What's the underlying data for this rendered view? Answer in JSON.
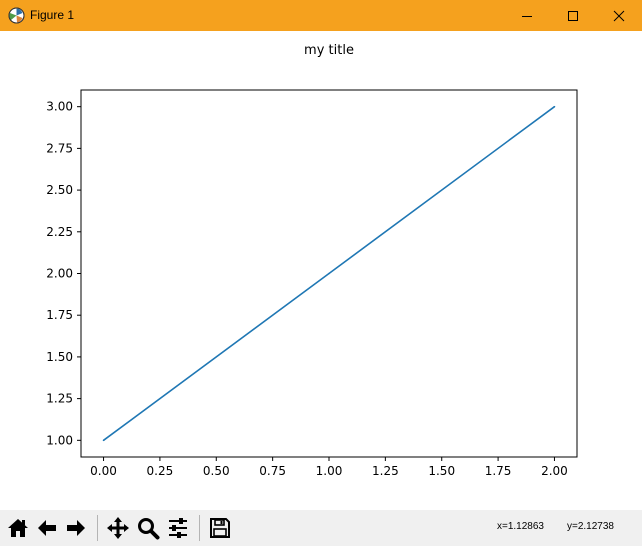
{
  "window": {
    "title": "Figure 1",
    "app_icon": "matplotlib-icon",
    "controls": [
      "minimize-icon",
      "maximize-icon",
      "close-icon"
    ],
    "titlebar_color": "#f5a11e"
  },
  "toolbar": {
    "buttons": [
      {
        "name": "home-button",
        "icon": "home-icon"
      },
      {
        "name": "back-button",
        "icon": "arrow-left-icon"
      },
      {
        "name": "forward-button",
        "icon": "arrow-right-icon"
      },
      {
        "name": "pan-button",
        "icon": "move-icon"
      },
      {
        "name": "zoom-button",
        "icon": "zoom-icon"
      },
      {
        "name": "configure-subplots-button",
        "icon": "sliders-icon"
      },
      {
        "name": "save-button",
        "icon": "save-icon"
      }
    ],
    "x_readout": "x=1.12863",
    "y_readout": "y=2.12738"
  },
  "chart_data": {
    "type": "line",
    "title": "my title",
    "xlabel": "",
    "ylabel": "",
    "x": [
      0,
      1,
      2
    ],
    "series": [
      {
        "values": [
          1,
          2,
          3
        ],
        "color": "#1f77b4"
      }
    ],
    "xlim": [
      -0.1,
      2.1
    ],
    "ylim": [
      0.9,
      3.1
    ],
    "xticks": [
      "0.00",
      "0.25",
      "0.50",
      "0.75",
      "1.00",
      "1.25",
      "1.50",
      "1.75",
      "2.00"
    ],
    "yticks": [
      "1.00",
      "1.25",
      "1.50",
      "1.75",
      "2.00",
      "2.25",
      "2.50",
      "2.75",
      "3.00"
    ],
    "grid": false
  }
}
